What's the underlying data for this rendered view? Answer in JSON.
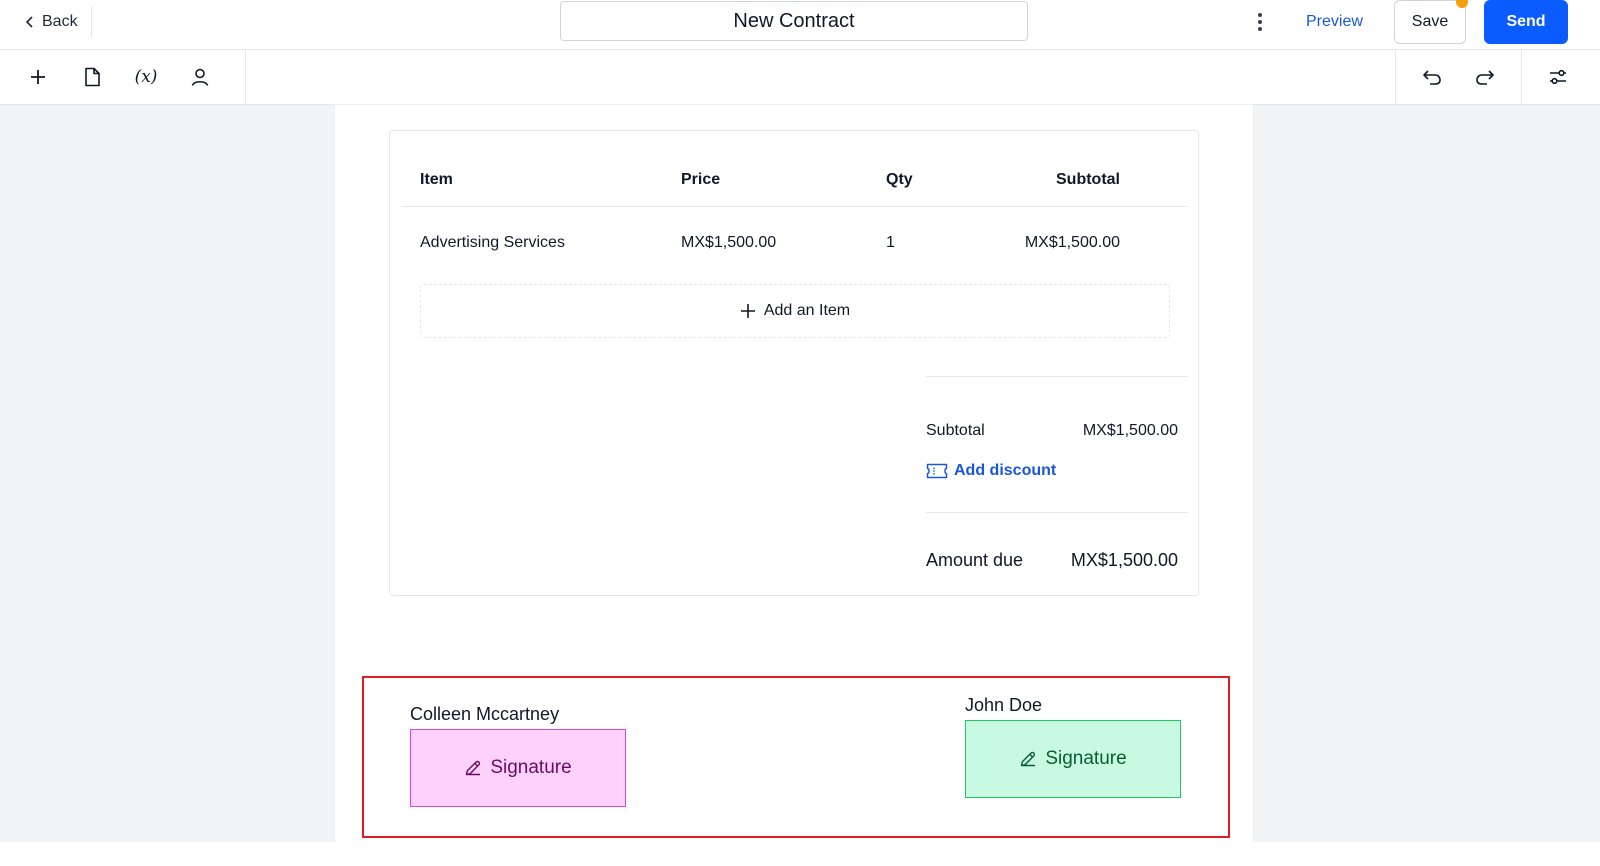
{
  "topbar": {
    "back_label": "Back",
    "document_title": "New Contract",
    "preview_label": "Preview",
    "save_label": "Save",
    "send_label": "Send",
    "colors": {
      "accent": "#0b5cff",
      "link": "#1a56db",
      "unsaved_dot": "#f59e0b"
    }
  },
  "toolbar": {
    "tools": [
      {
        "name": "plus-icon",
        "label": ""
      },
      {
        "name": "document-icon",
        "label": ""
      },
      {
        "name": "variable-icon",
        "label": "(x)"
      },
      {
        "name": "user-icon",
        "label": ""
      }
    ],
    "right_tools": [
      "undo-icon",
      "redo-icon",
      "settings-sliders-icon"
    ]
  },
  "pricing_table": {
    "headers": {
      "item": "Item",
      "price": "Price",
      "qty": "Qty",
      "subtotal": "Subtotal"
    },
    "rows": [
      {
        "item": "Advertising Services",
        "price": "MX$1,500.00",
        "qty": "1",
        "subtotal": "MX$1,500.00"
      }
    ],
    "add_item_label": "Add an Item",
    "summary": {
      "subtotal_label": "Subtotal",
      "subtotal_value": "MX$1,500.00",
      "add_discount_label": "Add discount",
      "amount_due_label": "Amount due",
      "amount_due_value": "MX$1,500.00"
    }
  },
  "signatures": {
    "signers": [
      {
        "name": "Colleen Mccartney",
        "field_label": "Signature",
        "color": "#fdd1fb"
      },
      {
        "name": "John Doe",
        "field_label": "Signature",
        "color": "#c8f9e1"
      }
    ],
    "highlight_color": "#e11d1d"
  }
}
